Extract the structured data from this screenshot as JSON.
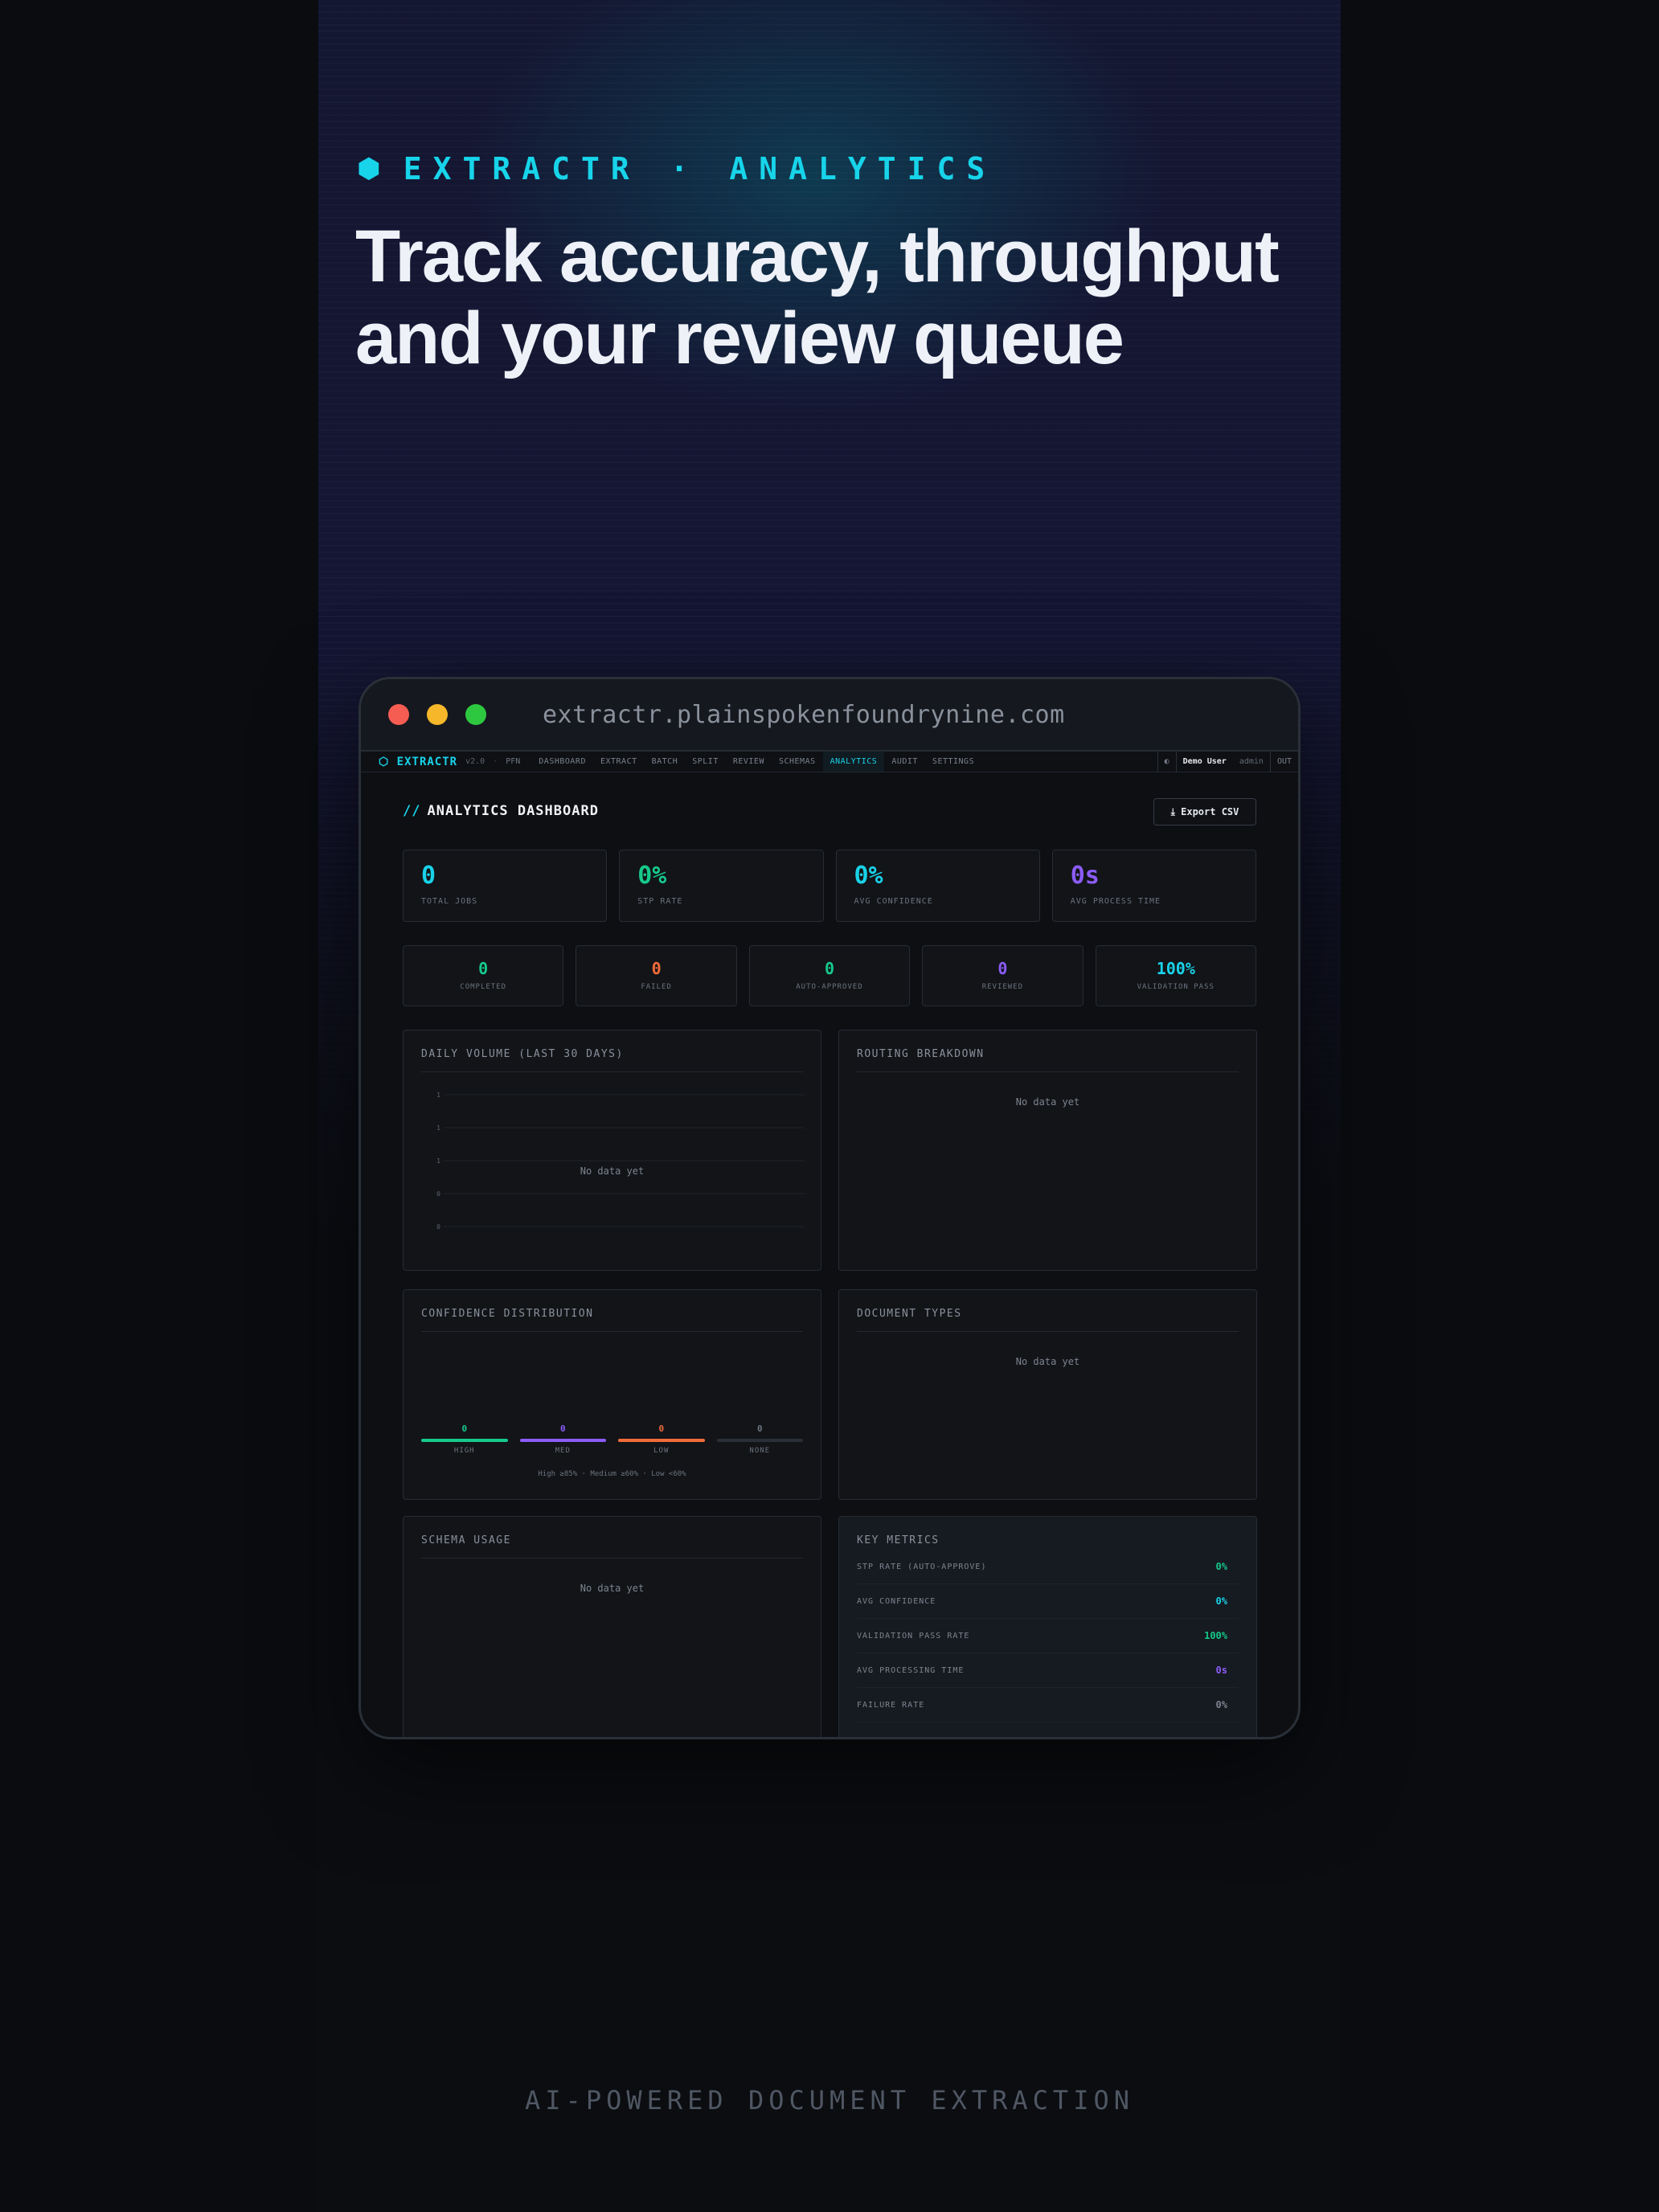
{
  "hero": {
    "brand_icon": "hexagon-icon",
    "brand_text": "EXTRACTR · ANALYTICS",
    "headline_line1": "Track accuracy, throughput",
    "headline_line2": "and your review queue",
    "footer": "AI-POWERED DOCUMENT EXTRACTION"
  },
  "browser": {
    "url": "extractr.plainspokenfoundrynine.com"
  },
  "appnav": {
    "logo": "⬡ EXTRACTR",
    "version": "v2.0",
    "separator": "·",
    "prefix": "PFN",
    "items": [
      "DASHBOARD",
      "EXTRACT",
      "BATCH",
      "SPLIT",
      "REVIEW",
      "SCHEMAS",
      "ANALYTICS",
      "AUDIT",
      "SETTINGS"
    ],
    "active_item": "ANALYTICS",
    "theme_toggle": "◐",
    "user": "Demo User",
    "role": "admin",
    "logout": "OUT"
  },
  "page": {
    "title_prefix": "//",
    "title": "ANALYTICS DASHBOARD",
    "export_label": "⤓ Export CSV"
  },
  "stats": [
    {
      "value": "0",
      "label": "TOTAL JOBS",
      "color": "#19d2e8"
    },
    {
      "value": "0%",
      "label": "STP RATE",
      "color": "#16c98a"
    },
    {
      "value": "0%",
      "label": "AVG CONFIDENCE",
      "color": "#19d2e8"
    },
    {
      "value": "0s",
      "label": "AVG PROCESS TIME",
      "color": "#8b5cf6"
    }
  ],
  "mini_stats": [
    {
      "value": "0",
      "label": "COMPLETED",
      "color": "#16c98a"
    },
    {
      "value": "0",
      "label": "FAILED",
      "color": "#f26b3a"
    },
    {
      "value": "0",
      "label": "AUTO-APPROVED",
      "color": "#16c98a"
    },
    {
      "value": "0",
      "label": "REVIEWED",
      "color": "#8b5cf6"
    },
    {
      "value": "100%",
      "label": "VALIDATION PASS",
      "color": "#19d2e8"
    }
  ],
  "panels": {
    "daily_volume": {
      "title": "DAILY VOLUME (LAST 30 DAYS)",
      "empty": "No data yet"
    },
    "routing": {
      "title": "ROUTING BREAKDOWN",
      "empty": "No data yet"
    },
    "confidence": {
      "title": "CONFIDENCE DISTRIBUTION",
      "legend": "High ≥85% · Medium ≥60% · Low <60%"
    },
    "doc_types": {
      "title": "DOCUMENT TYPES",
      "empty": "No data yet"
    },
    "schema_usage": {
      "title": "SCHEMA USAGE",
      "empty": "No data yet"
    },
    "key_metrics": {
      "title": "KEY METRICS"
    }
  },
  "chart_data": {
    "type": "bar",
    "title": "DAILY VOLUME (LAST 30 DAYS)",
    "y_ticks": [
      "1",
      "1",
      "1",
      "0",
      "0"
    ],
    "categories": [],
    "values": [],
    "grid": true
  },
  "confidence_buckets": [
    {
      "value": "0",
      "label": "HIGH",
      "color": "#16c98a"
    },
    {
      "value": "0",
      "label": "MED",
      "color": "#8b5cf6"
    },
    {
      "value": "0",
      "label": "LOW",
      "color": "#f26b3a"
    },
    {
      "value": "0",
      "label": "NONE",
      "color": "#2a2f37"
    }
  ],
  "key_metrics": [
    {
      "label": "STP RATE (AUTO-APPROVE)",
      "value": "0%",
      "color": "#16c98a"
    },
    {
      "label": "AVG CONFIDENCE",
      "value": "0%",
      "color": "#19d2e8"
    },
    {
      "label": "VALIDATION PASS RATE",
      "value": "100%",
      "color": "#16c98a"
    },
    {
      "label": "AVG PROCESSING TIME",
      "value": "0s",
      "color": "#8b5cf6"
    },
    {
      "label": "FAILURE RATE",
      "value": "0%",
      "color": "#7d848f"
    }
  ]
}
